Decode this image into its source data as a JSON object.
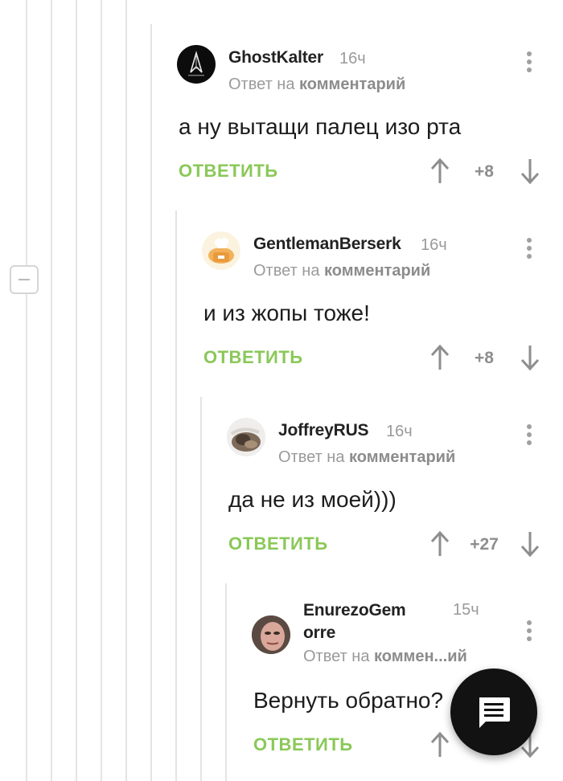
{
  "comments": [
    {
      "author": "GhostKalter",
      "time": "16ч",
      "reply_prefix": "Ответ на",
      "reply_target": "комментарий",
      "text": "а ну вытащи палец изо рта",
      "reply_label": "ОТВЕТИТЬ",
      "score": "+8",
      "avatar": "black-logo-avatar"
    },
    {
      "author": "GentlemanBerserk",
      "time": "16ч",
      "reply_prefix": "Ответ на",
      "reply_target": "комментарий",
      "text": "и из жопы тоже!",
      "reply_label": "ОТВЕТИТЬ",
      "score": "+8",
      "avatar": "chef-cartoon-avatar"
    },
    {
      "author": "JoffreyRUS",
      "time": "16ч",
      "reply_prefix": "Ответ на",
      "reply_target": "комментарий",
      "text": "да не из моей)))",
      "reply_label": "ОТВЕТИТЬ",
      "score": "+27",
      "avatar": "cat-photo-avatar"
    },
    {
      "author_line1": "EnurezoGem",
      "author_line2": "orre",
      "time": "15ч",
      "reply_prefix": "Ответ на",
      "reply_target": "коммен...ий",
      "text": "Вернуть обратно?",
      "reply_label": "ОТВЕТИТЬ",
      "avatar": "face-photo-avatar"
    }
  ],
  "icons": {
    "upvote": "arrow-up-icon",
    "downvote": "arrow-down-icon",
    "menu": "more-vertical-icon",
    "collapse": "minus-icon",
    "fab": "comment-icon"
  },
  "colors": {
    "reply_green": "#8ac858",
    "muted_gray": "#9a9a9a",
    "fab_background": "#121212"
  }
}
